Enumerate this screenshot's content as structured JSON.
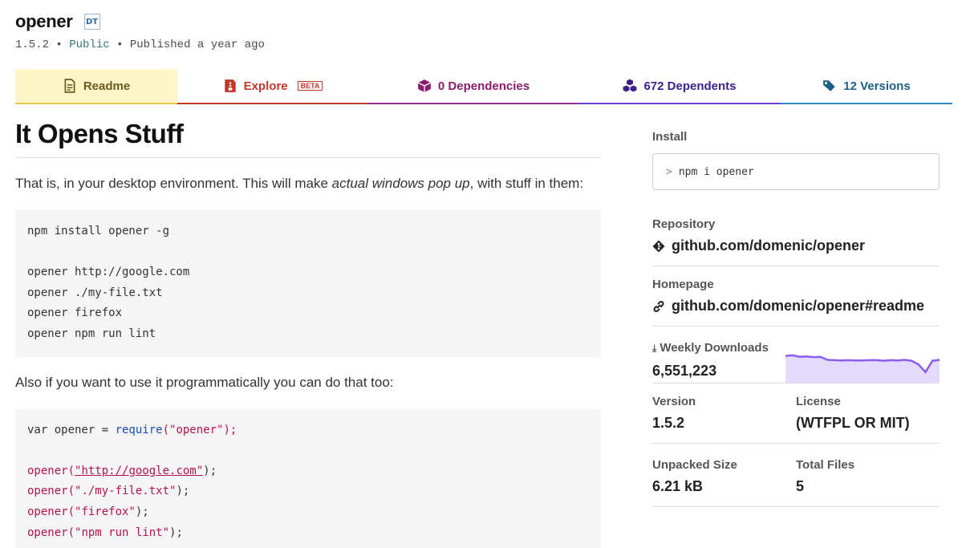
{
  "package": {
    "name": "opener",
    "badge": "DT",
    "version": "1.5.2",
    "separator": "•",
    "visibility": "Public",
    "published": "Published a year ago"
  },
  "tabs": [
    {
      "label": "Readme",
      "icon": "document-icon"
    },
    {
      "label": "Explore",
      "badge": "BETA",
      "icon": "file-archive-icon"
    },
    {
      "label": "0 Dependencies",
      "icon": "cube-icon"
    },
    {
      "label": "672 Dependents",
      "icon": "cubes-icon"
    },
    {
      "label": "12 Versions",
      "icon": "tags-icon"
    }
  ],
  "readme": {
    "heading": "It Opens Stuff",
    "intro_before": "That is, in your desktop environment. This will make ",
    "intro_em": "actual windows pop up",
    "intro_after": ", with stuff in them:",
    "code1": [
      "npm install opener -g",
      "",
      "opener http://google.com",
      "opener ./my-file.txt",
      "opener firefox",
      "opener npm run lint"
    ],
    "para2": "Also if you want to use it programmatically you can do that too:",
    "code2": {
      "line1_pre": "var opener = ",
      "line1_fn": "require",
      "line1_str": "(\"opener\");",
      "lines": [
        {
          "fn": "opener(",
          "str": "\"http://google.com\"",
          "end": ");"
        },
        {
          "fn": "opener(",
          "str": "\"./my-file.txt\"",
          "end": ");"
        },
        {
          "fn": "opener(",
          "str": "\"firefox\"",
          "end": ");"
        },
        {
          "fn": "opener(",
          "str": "\"npm run lint\"",
          "end": ");"
        }
      ]
    }
  },
  "sidebar": {
    "install_label": "Install",
    "install_cmd": "npm i opener",
    "install_prompt": ">",
    "repository_label": "Repository",
    "repository": "github.com/domenic/opener",
    "homepage_label": "Homepage",
    "homepage": "github.com/domenic/opener#readme",
    "downloads_label": "Weekly Downloads",
    "downloads": "6,551,223",
    "downloads_trend": [
      0.88,
      0.9,
      0.85,
      0.86,
      0.84,
      0.85,
      0.75,
      0.74,
      0.73,
      0.74,
      0.73,
      0.73,
      0.74,
      0.74,
      0.72,
      0.74,
      0.73,
      0.75,
      0.72,
      0.6,
      0.35,
      0.72,
      0.75
    ],
    "version_label": "Version",
    "version": "1.5.2",
    "license_label": "License",
    "license": "(WTFPL OR MIT)",
    "unpacked_label": "Unpacked Size",
    "unpacked": "6.21 kB",
    "files_label": "Total Files",
    "files": "5"
  },
  "colors": {
    "readme_tab": "#fdf4c8",
    "explore": "#c0392b",
    "dependencies": "#8b1c6e",
    "dependents": "#3b1f8b",
    "versions": "#1d5f86",
    "sparkline": "#8a5cf0"
  }
}
